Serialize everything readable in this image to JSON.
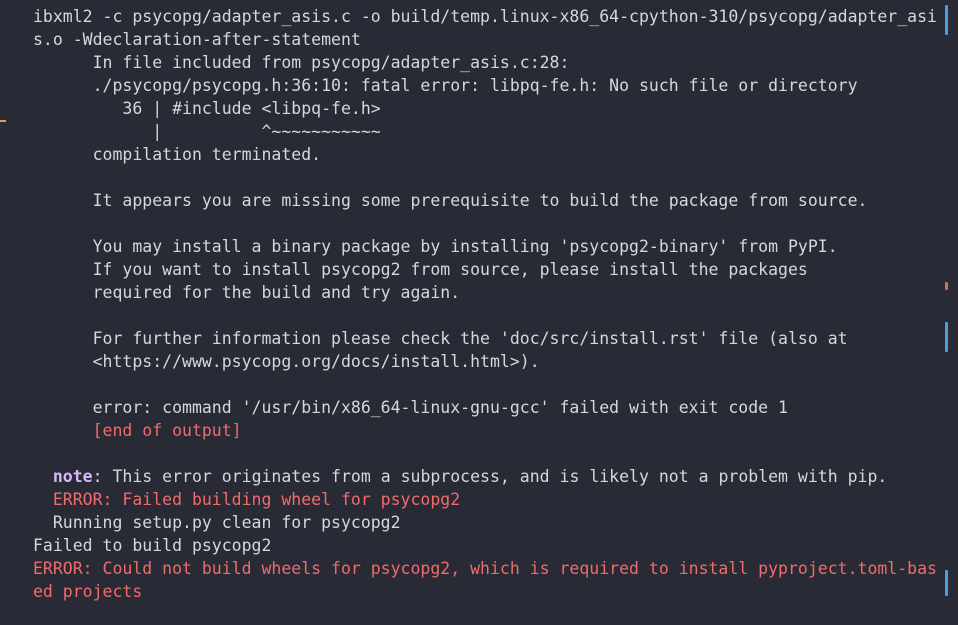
{
  "terminal": {
    "lines": [
      {
        "text": "ibxml2 -c psycopg/adapter_asis.c -o build/temp.linux-x86_64-cpython-310/psycopg/adapter_asi",
        "type": "normal"
      },
      {
        "text": "s.o -Wdeclaration-after-statement",
        "type": "normal"
      },
      {
        "text": "      In file included from psycopg/adapter_asis.c:28:",
        "type": "normal"
      },
      {
        "text": "      ./psycopg/psycopg.h:36:10: fatal error: libpq-fe.h: No such file or directory",
        "type": "normal"
      },
      {
        "text": "         36 | #include <libpq-fe.h>",
        "type": "normal"
      },
      {
        "text": "            |          ^~~~~~~~~~~~",
        "type": "normal"
      },
      {
        "text": "      compilation terminated.",
        "type": "normal"
      },
      {
        "text": "",
        "type": "blank"
      },
      {
        "text": "      It appears you are missing some prerequisite to build the package from source.",
        "type": "normal"
      },
      {
        "text": "",
        "type": "blank"
      },
      {
        "text": "      You may install a binary package by installing 'psycopg2-binary' from PyPI.",
        "type": "normal"
      },
      {
        "text": "      If you want to install psycopg2 from source, please install the packages",
        "type": "normal"
      },
      {
        "text": "      required for the build and try again.",
        "type": "normal"
      },
      {
        "text": "",
        "type": "blank"
      },
      {
        "text": "      For further information please check the 'doc/src/install.rst' file (also at",
        "type": "normal"
      },
      {
        "text": "      <https://www.psycopg.org/docs/install.html>).",
        "type": "normal"
      },
      {
        "text": "",
        "type": "blank"
      },
      {
        "text": "      error: command '/usr/bin/x86_64-linux-gnu-gcc' failed with exit code 1",
        "type": "normal"
      },
      {
        "text": "      [end of output]",
        "type": "error"
      },
      {
        "text": "",
        "type": "blank"
      },
      {
        "prefix": "  ",
        "label": "note",
        "text": ": This error originates from a subprocess, and is likely not a problem with pip.",
        "type": "note"
      },
      {
        "text": "  ERROR: Failed building wheel for psycopg2",
        "type": "error"
      },
      {
        "text": "  Running setup.py clean for psycopg2",
        "type": "normal"
      },
      {
        "text": "Failed to build psycopg2",
        "type": "normal"
      },
      {
        "text": "ERROR: Could not build wheels for psycopg2, which is required to install pyproject.toml-bas",
        "type": "error"
      },
      {
        "text": "ed projects",
        "type": "error"
      }
    ]
  },
  "colors": {
    "background": "#282b35",
    "text": "#d5d7dd",
    "error": "#f26a6a",
    "note": "#d7b8f5",
    "scroll_marker_blue": "#4a9fe0",
    "scroll_marker_red": "#e0665a",
    "gutter_marker": "#d9a441"
  }
}
